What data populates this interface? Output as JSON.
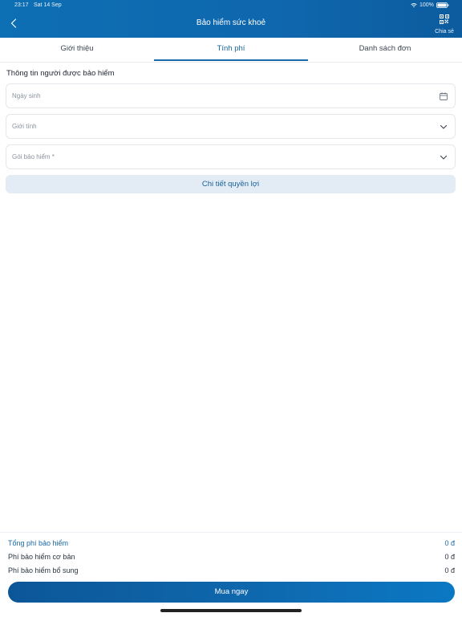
{
  "status_bar": {
    "time": "23:17",
    "date": "Sat 14 Sep",
    "battery": "100%"
  },
  "header": {
    "title": "Bảo hiểm sức khoẻ",
    "share_label": "Chia sẻ",
    "background_color": "#0d6fb4"
  },
  "tabs": [
    {
      "label": "Giới thiệu",
      "active": false
    },
    {
      "label": "Tính phí",
      "active": true
    },
    {
      "label": "Danh sách đơn",
      "active": false
    }
  ],
  "form": {
    "section_title": "Thông tin người được bảo hiểm",
    "fields": [
      {
        "label": "Ngày sinh",
        "icon": "calendar-icon"
      },
      {
        "label": "Giới tính",
        "icon": "chevron-down-icon"
      },
      {
        "label": "Gói bảo hiểm *",
        "icon": "chevron-down-icon"
      }
    ],
    "benefits_button": "Chi tiết quyền lợi"
  },
  "fees": {
    "total_label": "Tổng phí bảo hiểm",
    "total_value": "0 đ",
    "basic_label": "Phí bảo hiểm cơ bản",
    "basic_value": "0 đ",
    "extra_label": "Phí bảo hiểm bổ sung",
    "extra_value": "0 đ"
  },
  "buy_button": "Mua ngay",
  "colors": {
    "accent": "#1768a6",
    "button_light": "#e3ecf4"
  }
}
